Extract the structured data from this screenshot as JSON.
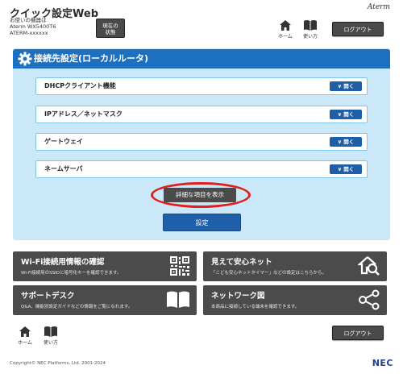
{
  "header": {
    "app_title": "クイック設定Web",
    "device_caption": "お使いの機器は",
    "model": "Aterm WX5400T6",
    "ssid": "ATERM-xxxxxx",
    "status_button_line1": "現在の",
    "status_button_line2": "状態",
    "brand": "Aterm",
    "home_label": "ホーム",
    "help_label": "使い方",
    "logout_label": "ログアウト"
  },
  "panel": {
    "title": "接続先設定(ローカルルータ)",
    "rows": [
      {
        "label": "DHCPクライアント機能",
        "button": "開く"
      },
      {
        "label": "IPアドレス／ネットマスク",
        "button": "開く"
      },
      {
        "label": "ゲートウェイ",
        "button": "開く"
      },
      {
        "label": "ネームサーバ",
        "button": "開く"
      }
    ],
    "detail_button": "詳細な項目を表示",
    "setting_button": "設定"
  },
  "tiles": [
    {
      "title": "Wi-Fi接続用情報の確認",
      "desc": "Wi-Fi接続用のSSIDと暗号化キーを確認できます。",
      "icon": "qr-code-icon"
    },
    {
      "title": "見えて安心ネット",
      "desc": "「こども安心ネットタイマー」などの設定はこちらから。",
      "icon": "home-search-icon"
    },
    {
      "title": "サポートデスク",
      "desc": "Q&A、機能別設定ガイドなどの情報をご覧になれます。",
      "icon": "book-icon"
    },
    {
      "title": "ネットワーク図",
      "desc": "本商品に接続している端末を確認できます。",
      "icon": "network-icon"
    }
  ],
  "footer": {
    "home_label": "ホーム",
    "help_label": "使い方",
    "logout_label": "ログアウト",
    "copyright": "Copyright© NEC Platforms, Ltd. 2001-2024",
    "logo": "NEC"
  },
  "colors": {
    "primary_blue": "#1e5fa8",
    "panel_bg": "#cbe8f8",
    "tile_bg": "#4b4b4b",
    "highlight_ring": "#e11d1d"
  }
}
